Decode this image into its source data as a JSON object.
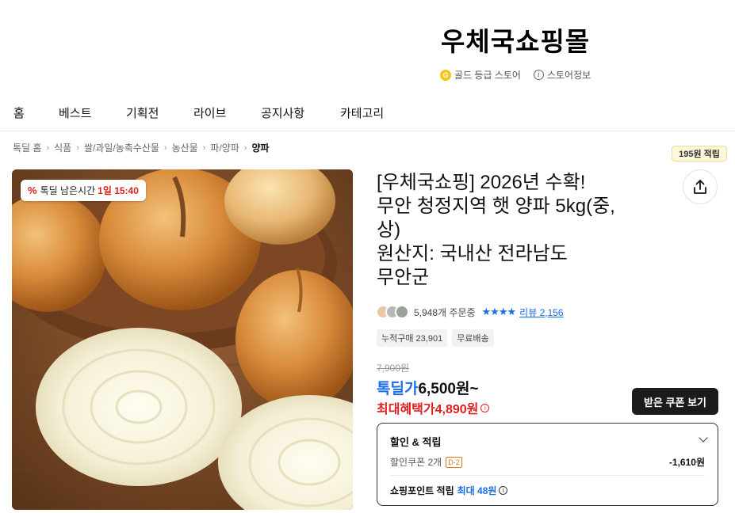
{
  "store": {
    "name": "우체국쇼핑몰",
    "grade_icon_letter": "G",
    "grade_label": "골드 등급 스토어",
    "info_icon_glyph": "i",
    "info_label": "스토어정보"
  },
  "nav": {
    "items": [
      "홈",
      "베스트",
      "기획전",
      "라이브",
      "공지사항",
      "카테고리"
    ]
  },
  "breadcrumb": {
    "items": [
      "톡딜 홈",
      "식품",
      "쌀/과일/농축수산물",
      "농산물",
      "파/양파"
    ],
    "current": "양파",
    "separator": "›"
  },
  "timer": {
    "icon": "%",
    "label": "톡딜 남은시간",
    "time": "1일 15:40"
  },
  "product": {
    "title_lines": [
      "[우체국쇼핑] 2026년 수확!",
      "무안 청정지역 햇 양파 5kg(중,",
      "상)",
      "원산지: 국내산 전라남도",
      "무안군"
    ]
  },
  "share": {
    "points_label": "195원 적립",
    "icon": "share-icon"
  },
  "social": {
    "order_count": "5,948개 주문중",
    "stars": "★★★★",
    "review_link": "리뷰 2,156"
  },
  "tags": [
    "누적구매 23,901",
    "무료배송"
  ],
  "price": {
    "original": "7,900원",
    "deal_label": "톡딜가",
    "deal_value": "6,500원~",
    "max_label": "최대혜택가",
    "max_value": "4,890원",
    "info_glyph": "i"
  },
  "coupon_button": {
    "label": "받은 쿠폰 보기"
  },
  "discount_box": {
    "title": "할인 & 적립",
    "coupon_label": "할인쿠폰 2개",
    "coupon_dday": "D-2",
    "coupon_amount": "-1,610원",
    "point_label": "쇼핑포인트 적립",
    "point_max": "최대 48원",
    "info_glyph": "i"
  },
  "colors": {
    "accent_blue": "#1a6ee8",
    "accent_red": "#e02020",
    "grade_gold": "#f5c518"
  }
}
